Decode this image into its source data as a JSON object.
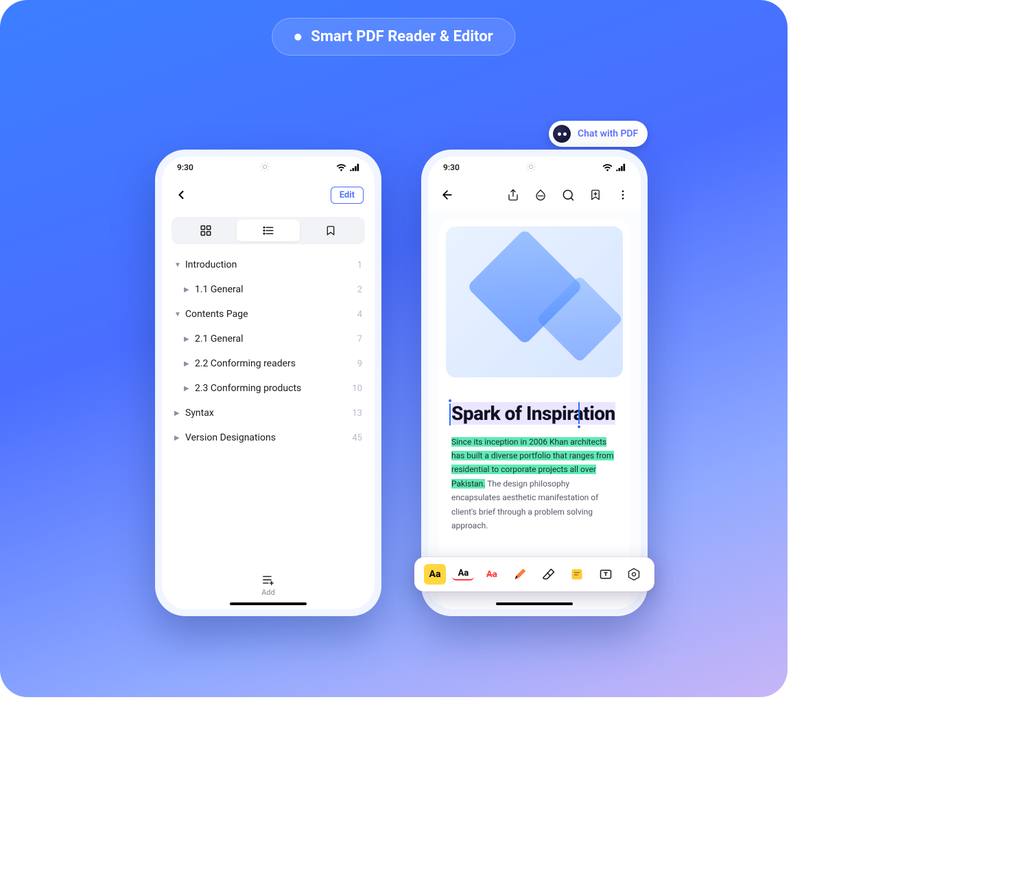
{
  "header": {
    "title": "Smart PDF Reader & Editor"
  },
  "chat_badge": {
    "label": "Chat with PDF"
  },
  "statusbar": {
    "time": "9:30"
  },
  "left_phone": {
    "edit_label": "Edit",
    "toc": [
      {
        "label": "Introduction",
        "page": "1",
        "level": 0,
        "expanded": true
      },
      {
        "label": "1.1 General",
        "page": "2",
        "level": 1,
        "expanded": false
      },
      {
        "label": "Contents Page",
        "page": "4",
        "level": 0,
        "expanded": true
      },
      {
        "label": "2.1 General",
        "page": "7",
        "level": 1,
        "expanded": false
      },
      {
        "label": "2.2 Conforming readers",
        "page": "9",
        "level": 1,
        "expanded": false
      },
      {
        "label": "2.3 Conforming products",
        "page": "10",
        "level": 1,
        "expanded": false
      },
      {
        "label": "Syntax",
        "page": "13",
        "level": 0,
        "expanded": false
      },
      {
        "label": "Version Designations",
        "page": "45",
        "level": 0,
        "expanded": false
      }
    ],
    "add_label": "Add"
  },
  "right_phone": {
    "doc_title": "Spark of Inspiration",
    "body_highlighted": "Since its inception in 2006 Khan architects has built a diverse portfolio that ranges from residential to corporate projects all over Pakistan.",
    "body_rest": " The design philosophy encapsulates aesthetic manifestation of client's brief through a problem solving approach."
  },
  "anno_tools": {
    "highlight": "Aa",
    "underline": "Aa",
    "strike": "Aa"
  }
}
